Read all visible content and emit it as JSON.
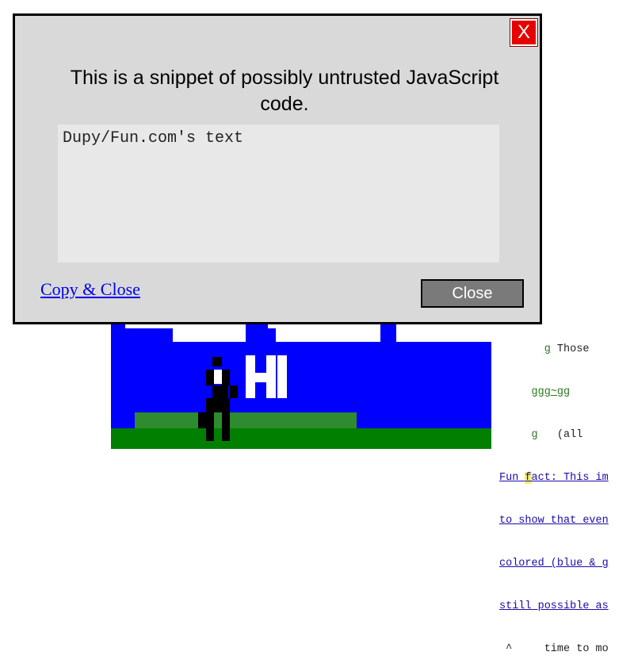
{
  "modal": {
    "close_x_label": "X",
    "title": "This is a snippet of possibly untrusted JavaScript code.",
    "code_text": "Dupy/Fun.com's text",
    "copy_close_label": "Copy & Close",
    "close_button_label": "Close"
  },
  "scene": {
    "sign_text": "HI",
    "colors": {
      "sky": "#0000ff",
      "cloud": "#ffffff",
      "grass_dark": "#007f00",
      "grass_light": "#2e8b2e",
      "figure": "#000000"
    }
  },
  "side_text": {
    "line1_prefix": "g",
    "line1_rest": " Those",
    "line2": "ggg~gg",
    "line3_prefix": "g",
    "line3_rest": "   (all",
    "fun_fact_a": "Fun ",
    "fun_fact_hl": "f",
    "fun_fact_b": "act: This im",
    "line5": "to show that even",
    "line6": "colored (blue & g",
    "line7": "still possible as",
    "line8": " ^     time to mo"
  }
}
